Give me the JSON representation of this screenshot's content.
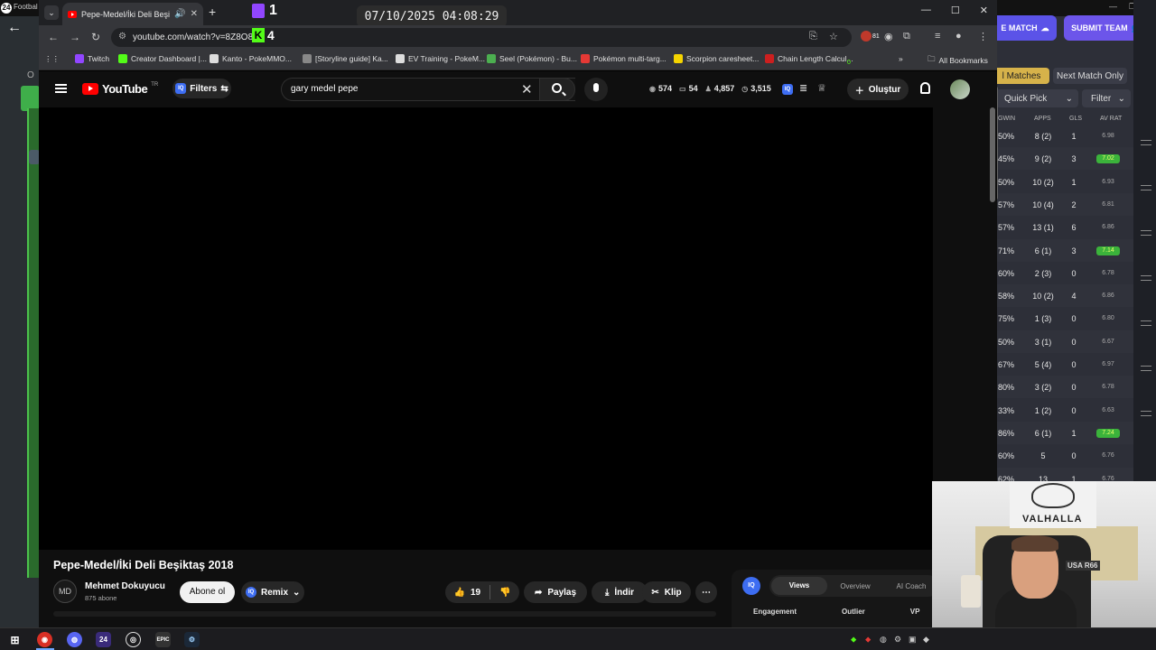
{
  "background_app": {
    "title": "Footbal",
    "match_button": "E MATCH",
    "submit_button": "SUBMIT TEAM",
    "tab_all_matches": "l Matches",
    "tab_next_match": "Next Match Only",
    "quick_pick": "Quick Pick",
    "filter": "Filter",
    "headers": [
      "GWIN",
      "APPS",
      "GLS",
      "AV RAT"
    ],
    "left_partial": "O",
    "rows": [
      {
        "gwin": "50%",
        "apps": "8 (2)",
        "gls": "1",
        "rat": "6.98",
        "hi": false
      },
      {
        "gwin": "45%",
        "apps": "9 (2)",
        "gls": "3",
        "rat": "7.02",
        "hi": true
      },
      {
        "gwin": "50%",
        "apps": "10 (2)",
        "gls": "1",
        "rat": "6.93",
        "hi": false
      },
      {
        "gwin": "57%",
        "apps": "10 (4)",
        "gls": "2",
        "rat": "6.81",
        "hi": false
      },
      {
        "gwin": "57%",
        "apps": "13 (1)",
        "gls": "6",
        "rat": "6.86",
        "hi": false
      },
      {
        "gwin": "71%",
        "apps": "6 (1)",
        "gls": "3",
        "rat": "7.14",
        "hi": true
      },
      {
        "gwin": "60%",
        "apps": "2 (3)",
        "gls": "0",
        "rat": "6.78",
        "hi": false
      },
      {
        "gwin": "58%",
        "apps": "10 (2)",
        "gls": "4",
        "rat": "6.86",
        "hi": false
      },
      {
        "gwin": "75%",
        "apps": "1 (3)",
        "gls": "0",
        "rat": "6.80",
        "hi": false
      },
      {
        "gwin": "50%",
        "apps": "3 (1)",
        "gls": "0",
        "rat": "6.67",
        "hi": false
      },
      {
        "gwin": "67%",
        "apps": "5 (4)",
        "gls": "0",
        "rat": "6.97",
        "hi": false
      },
      {
        "gwin": "80%",
        "apps": "3 (2)",
        "gls": "0",
        "rat": "6.78",
        "hi": false
      },
      {
        "gwin": "33%",
        "apps": "1 (2)",
        "gls": "0",
        "rat": "6.63",
        "hi": false
      },
      {
        "gwin": "86%",
        "apps": "6 (1)",
        "gls": "1",
        "rat": "7.24",
        "hi": true
      },
      {
        "gwin": "60%",
        "apps": "5",
        "gls": "0",
        "rat": "6.76",
        "hi": false
      },
      {
        "gwin": "62%",
        "apps": "13",
        "gls": "1",
        "rat": "6.76",
        "hi": false
      }
    ]
  },
  "overlay": {
    "twitch_count": "1",
    "kick_count": "4",
    "clock": "07/10/2025 04:08:29"
  },
  "browser": {
    "tab_title": "Pepe-Medel/İki Deli Beşiktaş 2018",
    "url": "youtube.com/watch?v=8Z8O8",
    "bookmarks": [
      {
        "label": "Twitch",
        "color": "#9146ff"
      },
      {
        "label": "Creator Dashboard |...",
        "color": "#53fc18"
      },
      {
        "label": "Kanto - PokeMMO...",
        "color": "#dddddd"
      },
      {
        "label": "[Storyline guide] Ka...",
        "color": "#888888"
      },
      {
        "label": "EV Training - PokeM...",
        "color": "#dddddd"
      },
      {
        "label": "Seel (Pokémon) - Bu...",
        "color": "#4caf50"
      },
      {
        "label": "Pokémon multi-targ...",
        "color": "#e53935"
      },
      {
        "label": "Scorpion caresheet...",
        "color": "#f5d400"
      },
      {
        "label": "Chain Length Calcul...",
        "color": "#cc1f1f"
      }
    ],
    "all_bookmarks": "All Bookmarks",
    "ext_badge": "81",
    "bookmark_badge": "0"
  },
  "youtube": {
    "logo": "YouTube",
    "region": "TR",
    "filters": "Filters",
    "search_value": "gary medel pepe",
    "stats": [
      {
        "icon": "eye",
        "value": "574"
      },
      {
        "icon": "comment",
        "value": "54"
      },
      {
        "icon": "like",
        "value": "4,857"
      },
      {
        "icon": "clock",
        "value": "3,515"
      }
    ],
    "create": "Oluştur",
    "video_title": "Pepe-Medel/İki Deli Beşiktaş 2018",
    "channel_name": "Mehmet Dokuyucu",
    "channel_subs": "875 abone",
    "subscribe": "Abone ol",
    "remix": "Remix",
    "likes": "19",
    "share": "Paylaş",
    "download": "İndir",
    "clip": "Klip",
    "iq_tabs": [
      "Views",
      "Overview",
      "AI Coach"
    ],
    "iq_sub": [
      "Engagement",
      "Outlier",
      "VP"
    ],
    "iq_label": "IQ"
  },
  "webcam": {
    "banner": "VALHALLA",
    "usa": "USA R66"
  }
}
